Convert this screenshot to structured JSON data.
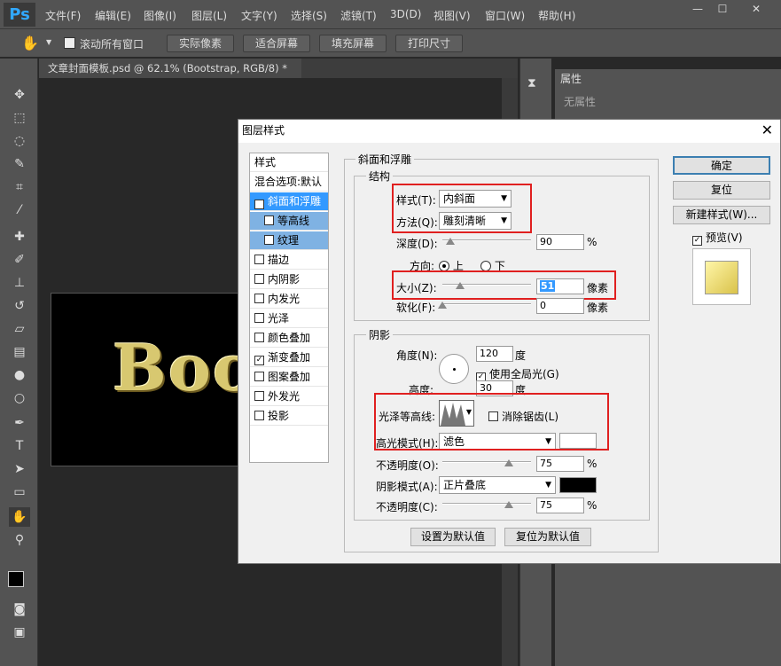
{
  "menubar": {
    "logo": "Ps",
    "items": [
      "文件(F)",
      "编辑(E)",
      "图像(I)",
      "图层(L)",
      "文字(Y)",
      "选择(S)",
      "滤镜(T)",
      "3D(D)",
      "视图(V)",
      "窗口(W)",
      "帮助(H)"
    ],
    "minimize": "—",
    "restore": "☐",
    "close": "✕"
  },
  "optbar": {
    "scroll_all": "滚动所有窗口",
    "btn_actual": "实际像素",
    "btn_fit": "适合屏幕",
    "btn_fill": "填充屏幕",
    "btn_print": "打印尺寸"
  },
  "document": {
    "tab_title": "文章封面模板.psd @ 62.1% (Bootstrap, RGB/8) *",
    "close": "×",
    "canvas_text": "Boo"
  },
  "properties": {
    "title": "属性",
    "empty": "无属性"
  },
  "dialog": {
    "title": "图层样式",
    "close": "✕",
    "styles_header": "样式",
    "blend_options": "混合选项:默认",
    "style_items": [
      {
        "label": "斜面和浮雕",
        "checked": true,
        "selected": true
      },
      {
        "label": "等高线",
        "checked": false,
        "sub": true
      },
      {
        "label": "纹理",
        "checked": false,
        "sub": true
      },
      {
        "label": "描边",
        "checked": false
      },
      {
        "label": "内阴影",
        "checked": false
      },
      {
        "label": "内发光",
        "checked": false
      },
      {
        "label": "光泽",
        "checked": false
      },
      {
        "label": "颜色叠加",
        "checked": false
      },
      {
        "label": "渐变叠加",
        "checked": true
      },
      {
        "label": "图案叠加",
        "checked": false
      },
      {
        "label": "外发光",
        "checked": false
      },
      {
        "label": "投影",
        "checked": false
      }
    ],
    "bevel_title": "斜面和浮雕",
    "structure": {
      "title": "结构",
      "style_label": "样式(T):",
      "style_value": "内斜面",
      "technique_label": "方法(Q):",
      "technique_value": "雕刻清晰",
      "depth_label": "深度(D):",
      "depth_value": "90",
      "depth_unit": "%",
      "depth_level": 0.09,
      "direction_label": "方向:",
      "dir_up": "上",
      "dir_down": "下",
      "size_label": "大小(Z):",
      "size_value": "51",
      "size_unit": "像素",
      "size_level": 0.2,
      "soften_label": "软化(F):",
      "soften_value": "0",
      "soften_unit": "像素",
      "soften_level": 0
    },
    "shading": {
      "title": "阴影",
      "angle_label": "角度(N):",
      "angle_value": "120",
      "angle_unit": "度",
      "global_light": "使用全局光(G)",
      "altitude_label": "高度:",
      "altitude_value": "30",
      "altitude_unit": "度",
      "gloss_label": "光泽等高线:",
      "anti_alias": "消除锯齿(L)",
      "highlight_mode_label": "高光模式(H):",
      "highlight_mode": "滤色",
      "highlight_color": "#ffffff",
      "opacity_label": "不透明度(O):",
      "highlight_opacity": "75",
      "highlight_opacity_level": 0.75,
      "opacity_unit": "%",
      "shadow_mode_label": "阴影模式(A):",
      "shadow_mode": "正片叠底",
      "shadow_color": "#000000",
      "shadow_opacity_label": "不透明度(C):",
      "shadow_opacity": "75",
      "shadow_opacity_level": 0.75
    },
    "make_default": "设置为默认值",
    "reset_default": "复位为默认值",
    "ok": "确定",
    "reset": "复位",
    "new_style": "新建样式(W)...",
    "preview": "预览(V)"
  }
}
